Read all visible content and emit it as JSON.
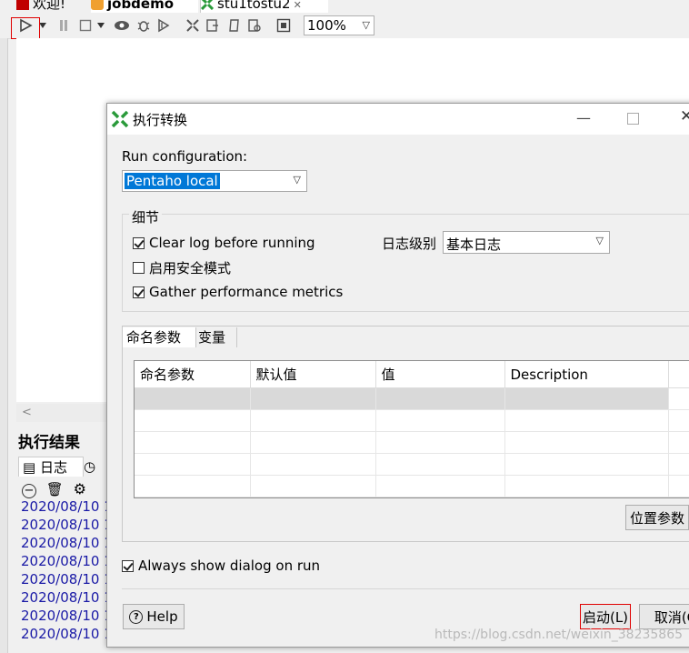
{
  "ide": {
    "tabs": [
      {
        "label": "欢迎!"
      },
      {
        "label": "jobdemo"
      },
      {
        "label": "stu1tostu2"
      }
    ],
    "zoom_value": "100%",
    "results": {
      "title": "执行结果",
      "tab_log": "日志",
      "log_lines": [
        "2020/08/10 1",
        "2020/08/10 1",
        "2020/08/10 1",
        "2020/08/10 1",
        "2020/08/10 1",
        "2020/08/10 1",
        "2020/08/10 1",
        "2020/08/10 1"
      ]
    }
  },
  "dialog": {
    "title": "执行转换",
    "run_config_label": "Run configuration:",
    "run_config_value": "Pentaho local",
    "details_title": "细节",
    "clear_log_label": "Clear log before running",
    "clear_log_checked": true,
    "safe_mode_label": "启用安全模式",
    "safe_mode_checked": false,
    "gather_metrics_label": "Gather performance metrics",
    "gather_metrics_checked": true,
    "log_level_label": "日志级别",
    "log_level_value": "基本日志",
    "tabs": [
      "命名参数",
      "变量"
    ],
    "params_table": {
      "columns": [
        "命名参数",
        "默认值",
        "值",
        "Description"
      ],
      "rows": [
        [
          "",
          "",
          "",
          ""
        ],
        [
          "",
          "",
          "",
          ""
        ],
        [
          "",
          "",
          "",
          ""
        ],
        [
          "",
          "",
          "",
          ""
        ],
        [
          "",
          "",
          "",
          ""
        ]
      ]
    },
    "position_params_button": "位置参数",
    "always_show_label": "Always show dialog on run",
    "always_show_checked": true,
    "help_button": "Help",
    "start_button": "启动(L)",
    "cancel_button": "取消(C"
  },
  "watermark": "https://blog.csdn.net/weixin_38235865"
}
